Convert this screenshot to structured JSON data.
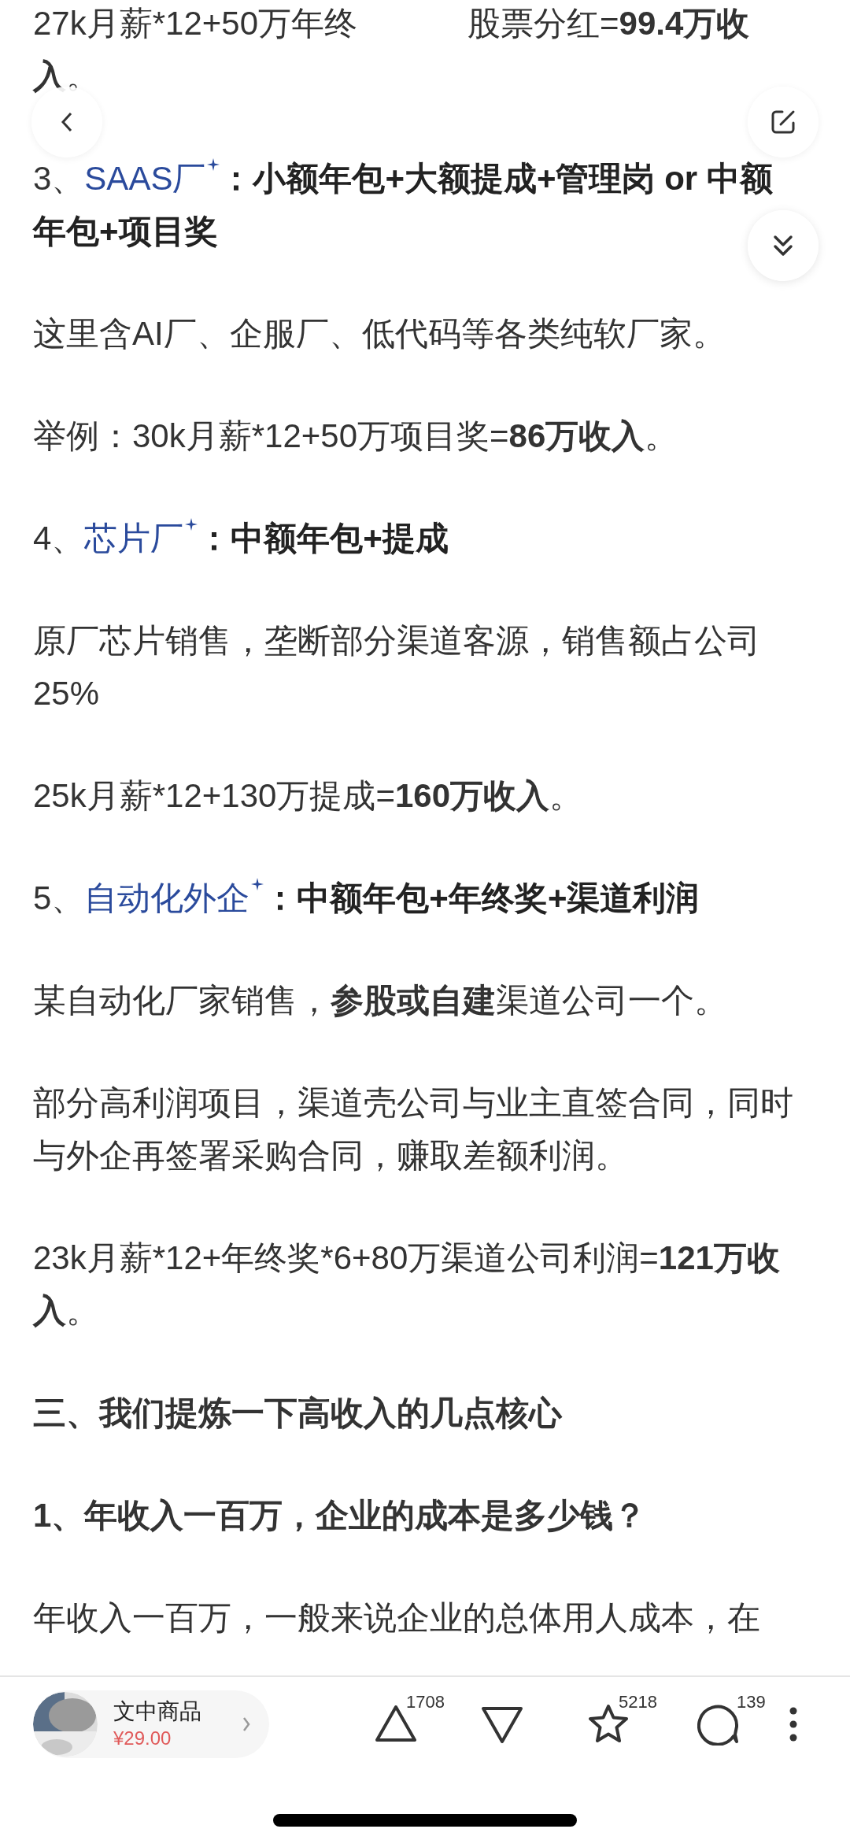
{
  "article": [
    {
      "kind": "split",
      "parts": [
        "27k月薪*12+50万年终",
        "股票分红=**99.4万收入**。"
      ]
    },
    {
      "kind": "heading",
      "number": "3、",
      "link": "SAAS厂",
      "text": "：小额年包+大额提成+管理岗 or 中额年包+项目奖"
    },
    {
      "kind": "body",
      "text": "这里含AI厂、企服厂、低代码等各类纯软厂家。"
    },
    {
      "kind": "body",
      "text": "举例：30k月薪*12+50万项目奖=**86万收入**。"
    },
    {
      "kind": "heading",
      "number": "4、",
      "link": "芯片厂",
      "text": "：中额年包+提成"
    },
    {
      "kind": "body",
      "text": "原厂芯片销售，垄断部分渠道客源，销售额占公司25%"
    },
    {
      "kind": "body",
      "text": "25k月薪*12+130万提成=**160万收入**。"
    },
    {
      "kind": "heading",
      "number": "5、",
      "link": "自动化外企",
      "text": "：中额年包+年终奖+渠道利润"
    },
    {
      "kind": "body",
      "text": "某自动化厂家销售，**参股或自建**渠道公司一个。"
    },
    {
      "kind": "body",
      "text": "部分高利润项目，渠道壳公司与业主直签合同，同时与外企再签署采购合同，赚取差额利润。"
    },
    {
      "kind": "body",
      "text": "23k月薪*12+年终奖*6+80万渠道公司利润=**121万收入**。"
    },
    {
      "kind": "section",
      "text": "三、我们提炼一下高收入的几点核心"
    },
    {
      "kind": "section",
      "text": "1、年收入一百万，企业的成本是多少钱？"
    },
    {
      "kind": "body",
      "text": "年收入一百万，一般来说企业的总体用人成本，在"
    }
  ],
  "bottom_bar": {
    "product": {
      "title": "文中商品",
      "price": "¥29.00"
    },
    "actions": [
      {
        "kind": "upvote",
        "count": "1708"
      },
      {
        "kind": "downvote"
      },
      {
        "kind": "favorite",
        "count": "5218"
      },
      {
        "kind": "comment",
        "count": "139"
      },
      {
        "kind": "more"
      }
    ]
  }
}
